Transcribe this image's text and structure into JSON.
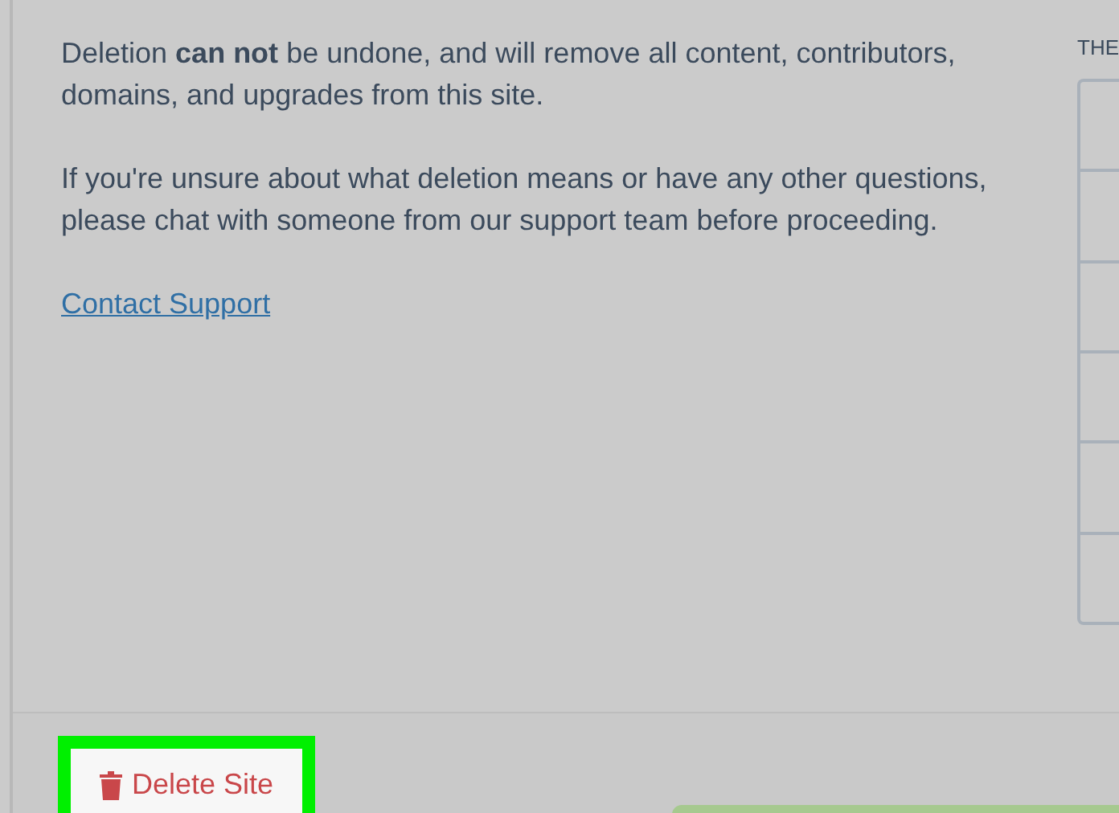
{
  "paragraphs": [
    "Deletion **can not** be undone, and will remove all content, contributors, domains, and upgrades from this site.",
    "If you're unsure about what deletion means or have any other questions, please chat with someone from our support team before proceeding."
  ],
  "link": "Contact Support",
  "side_panel": {
    "heading": "THE"
  },
  "delete_button": {
    "label": "Delete Site",
    "highlighted": true
  }
}
